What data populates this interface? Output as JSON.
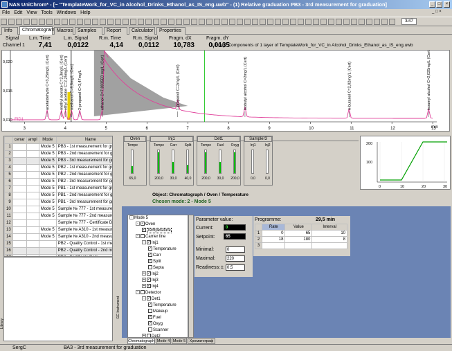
{
  "window": {
    "title": "NAS UniChrom* - [~ \"TemplateWork_for_VC_in Alcohol_Drinks_Ethanol_as_IS_eng.uwb\" - (1) Relative graduation PB3 - 3rd measurement for graduation]"
  },
  "menu": [
    "File",
    "Edit",
    "View",
    "Tools",
    "Windows",
    "Help"
  ],
  "toolbar": {
    "counter": "3/47"
  },
  "tabs": [
    "Info",
    "Chromatogram",
    "Macros",
    "Samples",
    "Report",
    "Calculator",
    "Properties"
  ],
  "info_headers": {
    "signal": "Signal",
    "lm_time": "L.m. Time",
    "lm_signal": "L.m. Signal",
    "rm_time": "R.m. Time",
    "rm_signal": "R.m. Signal",
    "fragm_dx": "Fragm. dX",
    "fragm_dy": "Fragm. dY"
  },
  "info_values": {
    "channel": "Channel 1",
    "lm_time": "7,41",
    "lm_signal": "0,0122",
    "rm_time": "4,14",
    "rm_signal": "0,0112",
    "fragm_dx": "10,783",
    "fragm_dy": "0,0135"
  },
  "library": "Library: Components of 1 layer of TemplateWork_for_VC_in Alcohol_Drinks_Ethanol_as_IS_eng.uwb",
  "chart_data": {
    "type": "line",
    "x_ticks": [
      "3",
      "4",
      "5",
      "6",
      "7",
      "8",
      "9",
      "10",
      "11",
      "12",
      "13"
    ],
    "x_unit": "min",
    "y_ticks": [
      "0,020",
      "0,015",
      "0,010"
    ],
    "series_label": "FID1",
    "peaks": [
      {
        "time": 3.55,
        "label": "acetaldehyde C=3,25mg/L (Cert)"
      },
      {
        "time": 3.9,
        "label": "methyl acetate C=2,3mg/L (Cert)"
      },
      {
        "time": 4.0,
        "label": "ethyl acetate C=2,25mg/L (Cert)"
      },
      {
        "time": 4.15,
        "label": "methanol C=6,8mg/L (Cert)"
      },
      {
        "time": 4.35,
        "label": "2-propanol C=3,47mg/L"
      },
      {
        "time": 4.9,
        "label": "ethanol C=7,8935E0 mg/L (Cert)"
      },
      {
        "time": 6.75,
        "label": "1-propanol C=2mg/L (Cert)"
      },
      {
        "time": 8.4,
        "label": "isobutyl alcohol C=2mg/L (Cert)"
      },
      {
        "time": 10.95,
        "label": "n-butanol C=2,02mg/L (Cert)"
      },
      {
        "time": 12.9,
        "label": "isoamyl alcohol C=2,025mg/L (Cert)"
      }
    ]
  },
  "samples": {
    "headers": [
      "",
      "cenar",
      "ampl",
      "Mode",
      "Name"
    ],
    "rows": [
      {
        "n": "1",
        "mode": "Mode 5",
        "name": "PB3 - 1st measurement for gradua"
      },
      {
        "n": "2",
        "mode": "Mode 5",
        "name": "PB3 - 2nd measurement for gradua"
      },
      {
        "n": "3",
        "mode": "Mode 5",
        "name": "PB3 - 3rd measurement for gra..."
      },
      {
        "n": "4",
        "mode": "Mode 5",
        "name": "PB2 - 1st measurement for gradua"
      },
      {
        "n": "5",
        "mode": "Mode 5",
        "name": "PB2 - 2nd measurement for gradua"
      },
      {
        "n": "6",
        "mode": "Mode 5",
        "name": "PB2 - 3rd measurement for gradua"
      },
      {
        "n": "7",
        "mode": "Mode 5",
        "name": "PB1 - 1st measurement for gradua"
      },
      {
        "n": "8",
        "mode": "Mode 5",
        "name": "PB1 - 2nd measurement for gradua"
      },
      {
        "n": "9",
        "mode": "Mode 5",
        "name": "PB1 - 3rd measurement for gradua"
      },
      {
        "n": "10",
        "mode": "Mode 5",
        "name": "Sample № 777 - 1st measureme"
      },
      {
        "n": "11",
        "mode": "Mode 5",
        "name": "Sample № 777 - 2nd measureme"
      },
      {
        "n": "12",
        "mode": "",
        "name": "Sample № 777 - Certificate Data"
      },
      {
        "n": "13",
        "mode": "Mode 5",
        "name": "Sample № A310 - 1st measureme"
      },
      {
        "n": "14",
        "mode": "Mode 5",
        "name": "Sample № A310 - 2nd measureme"
      },
      {
        "n": "15",
        "mode": "",
        "name": "PB2 - Quality Control - 1st meas"
      },
      {
        "n": "16",
        "mode": "",
        "name": "PB2 - Quality Control - 2nd me..."
      },
      {
        "n": "17",
        "mode": "",
        "name": "PB2 - Certificate Data"
      }
    ]
  },
  "instrument": {
    "groups": [
      {
        "name": "Oven",
        "items": [
          {
            "label": "Tempe",
            "value": "65,0",
            "level": 0.3
          }
        ]
      },
      {
        "name": "Inj1",
        "items": [
          {
            "label": "Tempe",
            "value": "200,0",
            "level": 0.9
          },
          {
            "label": "Carr",
            "value": "30,0",
            "level": 0.5
          },
          {
            "label": "Split",
            "value": "40,0",
            "level": 0.35
          }
        ]
      },
      {
        "name": "Det1",
        "items": [
          {
            "label": "Tempe",
            "value": "200,0",
            "level": 0.9
          },
          {
            "label": "Fuel",
            "value": "30,0",
            "level": 0.5
          },
          {
            "label": "Oxyg",
            "value": "200,0",
            "level": 0.9
          }
        ]
      },
      {
        "name": "Sampler3",
        "items": [
          {
            "label": "Inj1",
            "value": "0,0",
            "level": 0
          },
          {
            "label": "Inj2",
            "value": "0,0",
            "level": 0
          }
        ]
      }
    ],
    "bottom_values": [
      "0,0",
      "0,0",
      "0,0",
      "0,0",
      "0,0",
      "0,0",
      "0,0",
      "0,0",
      "0,0"
    ],
    "object_path": "Object: Chromatograph / Oven / Temperature",
    "chosen_mode": "Chosen mode: 2 - Mode 5"
  },
  "tprog_chart": {
    "x_ticks": [
      "0",
      "10",
      "20",
      "30"
    ],
    "y_ticks": [
      "200",
      "100"
    ]
  },
  "tree": [
    {
      "label": "Mode 5",
      "indent": 0,
      "check": false,
      "exp": "-"
    },
    {
      "label": "Oven",
      "indent": 1,
      "check": true,
      "exp": "-"
    },
    {
      "label": "Temperature",
      "indent": 2,
      "check": true,
      "exp": ""
    },
    {
      "label": "Carrier line",
      "indent": 1,
      "check": false,
      "exp": "-"
    },
    {
      "label": "Inj1",
      "indent": 2,
      "check": true,
      "exp": "-"
    },
    {
      "label": "Temperature",
      "indent": 3,
      "check": true,
      "exp": ""
    },
    {
      "label": "Carr",
      "indent": 3,
      "check": true,
      "exp": ""
    },
    {
      "label": "Split",
      "indent": 3,
      "check": true,
      "exp": ""
    },
    {
      "label": "Septa",
      "indent": 3,
      "check": false,
      "exp": ""
    },
    {
      "label": "Inj2",
      "indent": 2,
      "check": true,
      "exp": "+"
    },
    {
      "label": "Inj3",
      "indent": 2,
      "check": true,
      "exp": "+"
    },
    {
      "label": "Inj4",
      "indent": 2,
      "check": true,
      "exp": "+"
    },
    {
      "label": "Detector",
      "indent": 1,
      "check": false,
      "exp": "-"
    },
    {
      "label": "Det1",
      "indent": 2,
      "check": true,
      "exp": "-"
    },
    {
      "label": "Temperature",
      "indent": 3,
      "check": true,
      "exp": ""
    },
    {
      "label": "Makeup",
      "indent": 3,
      "check": false,
      "exp": ""
    },
    {
      "label": "Fuel",
      "indent": 3,
      "check": true,
      "exp": ""
    },
    {
      "label": "Oxyg",
      "indent": 3,
      "check": true,
      "exp": ""
    },
    {
      "label": "Scanner",
      "indent": 3,
      "check": false,
      "exp": ""
    },
    {
      "label": "Det2",
      "indent": 2,
      "check": false,
      "exp": "+"
    },
    {
      "label": "Det3",
      "indent": 2,
      "check": false,
      "exp": "+"
    },
    {
      "label": "Det4",
      "indent": 2,
      "check": false,
      "exp": "+"
    }
  ],
  "params": {
    "title": "Parameter value:",
    "current_label": "Current:",
    "current_val": "0",
    "setpoint_label": "Setpoint:",
    "setpoint_val": "65",
    "minimal_label": "Minimal:",
    "minimal_val": "0",
    "maximal_label": "Maximal:",
    "maximal_val": "220",
    "readiness_label": "Readiness:",
    "readiness_pm": "±",
    "readiness_val": "0,5"
  },
  "programme": {
    "title": "Programme:",
    "total": "29,5 min",
    "headers": [
      "",
      "Rate",
      "Value",
      "Interval"
    ],
    "rows": [
      [
        "1",
        "0",
        "65",
        "10"
      ],
      [
        "2",
        "18",
        "180",
        "8"
      ],
      [
        "3",
        "",
        "",
        ""
      ]
    ]
  },
  "bottom_tabs": [
    "Chromatograph",
    "Mode 4",
    "Mode 5",
    "Хроматограф"
  ],
  "side_labels": {
    "left": "Library",
    "right": "GC Instrument"
  },
  "status": {
    "left": "SergC",
    "right": "ВАЗ - 3rd measurement for graduation"
  }
}
